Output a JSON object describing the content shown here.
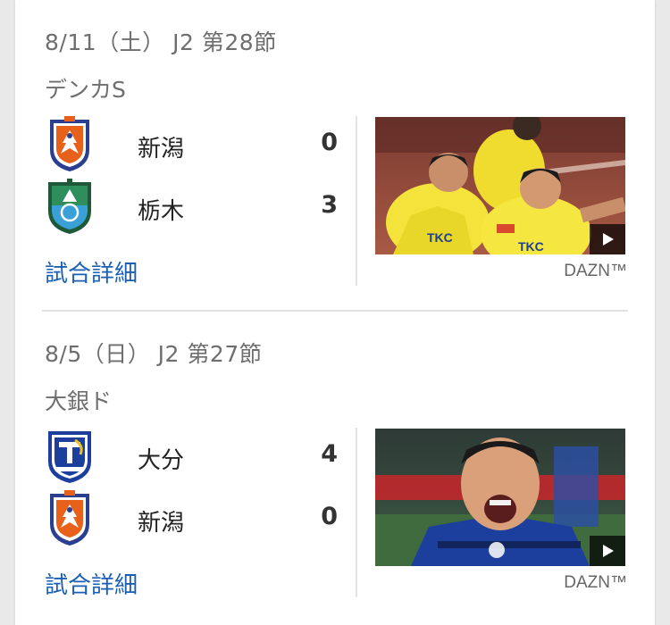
{
  "matches": [
    {
      "date_line": "8/11（土） J2 第28節",
      "venue": "デンカS",
      "home": {
        "name": "新潟",
        "score": "0",
        "crest": "albirex-crest-icon"
      },
      "away": {
        "name": "栃木",
        "score": "3",
        "crest": "tochigi-crest-icon"
      },
      "details_label": "試合詳細",
      "video": {
        "provider": "DAZN™",
        "play_icon": "play-icon"
      }
    },
    {
      "date_line": "8/5（日） J2 第27節",
      "venue": "大銀ド",
      "home": {
        "name": "大分",
        "score": "4",
        "crest": "trinita-crest-icon"
      },
      "away": {
        "name": "新潟",
        "score": "0",
        "crest": "albirex-crest-icon"
      },
      "details_label": "試合詳細",
      "video": {
        "provider": "DAZN™",
        "play_icon": "play-icon"
      }
    }
  ],
  "colors": {
    "link": "#1a5fb4",
    "muted_text": "#6e6e6e",
    "tochigi_yellow": "#f4e33a",
    "oita_blue": "#1c3f9e",
    "albirex_orange": "#e8611a"
  }
}
